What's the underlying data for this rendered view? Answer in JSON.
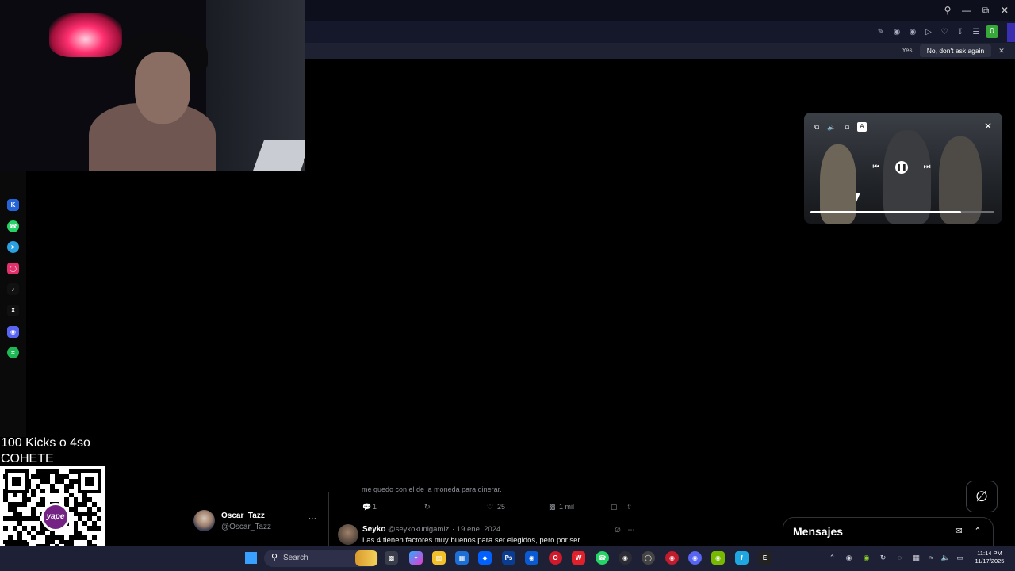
{
  "browser": {
    "prompt_yes": "Yes",
    "prompt_dont_ask": "No, don't ask again",
    "badge_count": "0"
  },
  "overlay": {
    "kick_line1": "100 Kicks o 4so",
    "kick_line2": "COHETE",
    "qr_logo": "yape"
  },
  "pip": {
    "progress": 0.82
  },
  "sidebar_icons": [
    "kick-icon",
    "whatsapp-icon",
    "telegram-icon",
    "instagram-icon",
    "tiktok-icon",
    "x-icon",
    "discord-icon",
    "spotify-icon"
  ],
  "profile": {
    "name": "Oscar_Tazz",
    "handle": "@Oscar_Tazz"
  },
  "feed": {
    "cut_text": "me quedo con el de la moneda para dinerar.",
    "replies": "1",
    "likes": "25",
    "views": "1 mil",
    "tweet": {
      "name": "Seyko",
      "handle": "@seykokunigamiz",
      "date": "· 19 ene. 2024",
      "text": "Las 4 tienen factores muy buenos para ser elegidos, pero por ser"
    }
  },
  "messages": {
    "title": "Mensajes"
  },
  "taskbar": {
    "search_placeholder": "Search",
    "time": "11:14 PM",
    "date": "11/17/2025"
  },
  "colors": {
    "accent_green": "#39a83a",
    "titlebar": "#0e0f1d",
    "taskbar": "#1e2136"
  }
}
